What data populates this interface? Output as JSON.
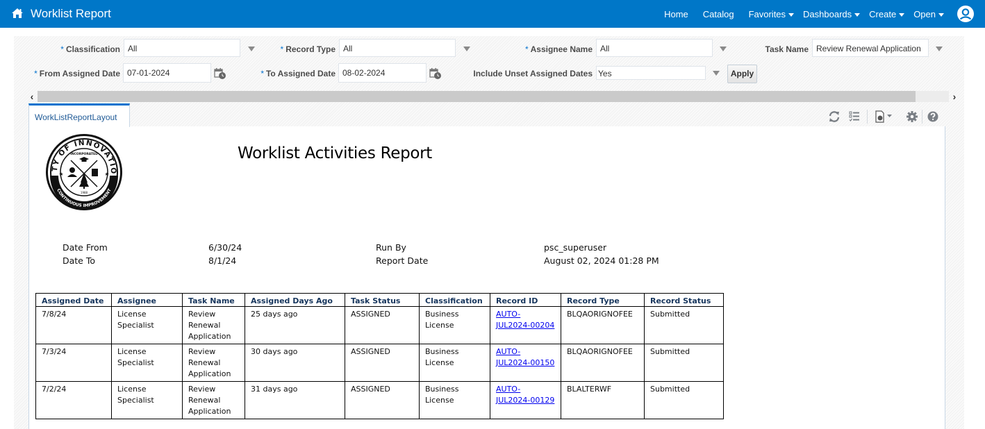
{
  "header": {
    "title": "Worklist Report",
    "nav": [
      {
        "label": "Home",
        "dropdown": false
      },
      {
        "label": "Catalog",
        "dropdown": false
      },
      {
        "label": "Favorites",
        "dropdown": true
      },
      {
        "label": "Dashboards",
        "dropdown": true
      },
      {
        "label": "Create",
        "dropdown": true
      },
      {
        "label": "Open",
        "dropdown": true
      }
    ],
    "brand_color": "#0077c8"
  },
  "prompts": {
    "classification": {
      "label": "Classification",
      "required": "*",
      "value": "All"
    },
    "record_type": {
      "label": "Record Type",
      "required": "*",
      "value": "All"
    },
    "assignee_name": {
      "label": "Assignee Name",
      "required": "*",
      "value": "All"
    },
    "task_name": {
      "label": "Task Name",
      "value": "Review Renewal Application"
    },
    "from_assigned_date": {
      "label": "From Assigned Date",
      "required": "*",
      "value": "07-01-2024"
    },
    "to_assigned_date": {
      "label": "To Assigned Date",
      "required": "*",
      "value": "08-02-2024"
    },
    "include_unset": {
      "label": "Include Unset Assigned Dates",
      "value": "Yes"
    },
    "apply_label": "Apply"
  },
  "tabs": [
    {
      "label": "WorkListReportLayout",
      "active": true
    }
  ],
  "toolbar_icons": [
    "refresh-icon",
    "list-icon",
    "export-icon",
    "settings-icon",
    "help-icon"
  ],
  "report": {
    "title": "Worklist Activities Report",
    "logo": {
      "top_text": "CITY OF INNOVATION",
      "inner_text": "INCORPORATED",
      "bottom_text": "CONTINUOUS IMPROVEMENT",
      "year": "1988"
    },
    "meta": {
      "date_from_label": "Date From",
      "date_from": "6/30/24",
      "date_to_label": "Date To",
      "date_to": "8/1/24",
      "run_by_label": "Run By",
      "run_by": "psc_superuser",
      "report_date_label": "Report Date",
      "report_date": "August 02, 2024 01:28 PM"
    },
    "table": {
      "columns": [
        "Assigned Date",
        "Assignee",
        "Task Name",
        "Assigned Days Ago",
        "Task Status",
        "Classification",
        "Record ID",
        "Record Type",
        "Record Status"
      ],
      "rows": [
        {
          "assigned_date": "7/8/24",
          "assignee": "License Specialist",
          "task_name": "Review Renewal Application",
          "days_ago": "25 days ago",
          "task_status": "ASSIGNED",
          "classification": "Business License",
          "record_id": "AUTO-JUL2024-00204",
          "record_type": "BLQAORIGNOFEE",
          "record_status": "Submitted"
        },
        {
          "assigned_date": "7/3/24",
          "assignee": "License Specialist",
          "task_name": "Review Renewal Application",
          "days_ago": "30 days ago",
          "task_status": "ASSIGNED",
          "classification": "Business License",
          "record_id": "AUTO-JUL2024-00150",
          "record_type": "BLQAORIGNOFEE",
          "record_status": "Submitted"
        },
        {
          "assigned_date": "7/2/24",
          "assignee": "License Specialist",
          "task_name": "Review Renewal Application",
          "days_ago": "31 days ago",
          "task_status": "ASSIGNED",
          "classification": "Business License",
          "record_id": "AUTO-JUL2024-00129",
          "record_type": "BLALTERWF",
          "record_status": "Submitted"
        }
      ]
    }
  }
}
